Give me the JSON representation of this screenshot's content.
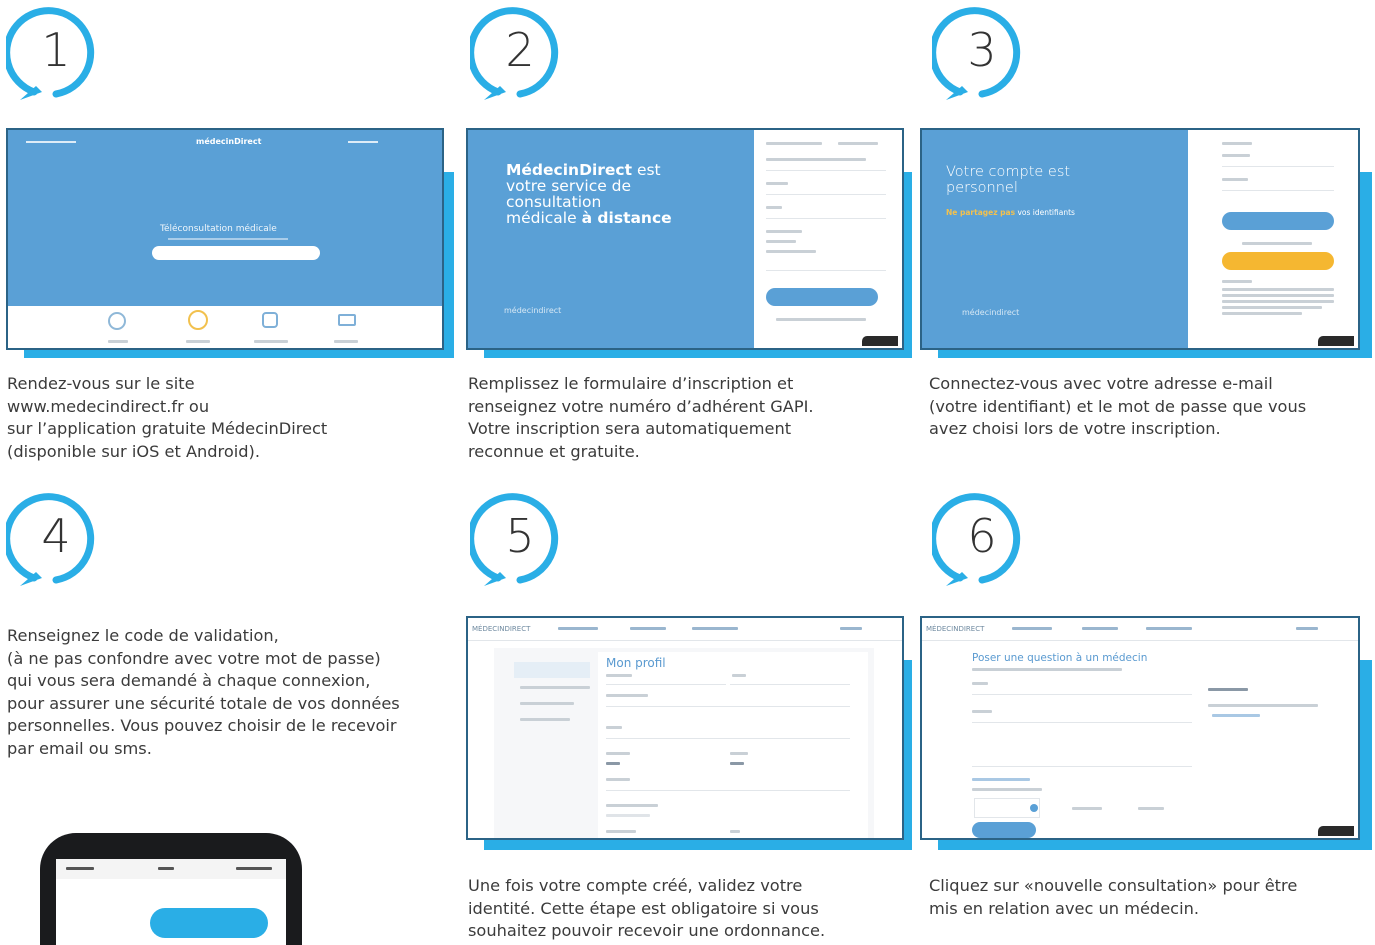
{
  "steps": [
    {
      "number": "1",
      "caption": "Rendez-vous sur le site\nwww.medecindirect.fr ou\nsur l’application gratuite MédecinDirect\n(disponible sur iOS et Android)."
    },
    {
      "number": "2",
      "caption": "Remplissez le formulaire d’inscription et\nrenseignez votre numéro d’adhérent GAPI.\nVotre inscription sera automatiquement\nreconnue et gratuite."
    },
    {
      "number": "3",
      "caption": "Connectez-vous avec votre adresse e-mail\n(votre identifiant) et le mot de passe que vous\navez choisi lors de votre inscription."
    },
    {
      "number": "4",
      "caption": "Renseignez le code de validation,\n(à ne pas confondre avec votre mot de passe)\nqui vous sera demandé à chaque connexion,\npour assurer une sécurité totale de vos données\npersonnelles. Vous pouvez choisir de le recevoir\npar email ou sms."
    },
    {
      "number": "5",
      "caption": "Une fois votre compte créé, validez votre\nidentité. Cette étape est obligatoire si vous\nsouhaitez pouvoir recevoir une ordonnance."
    },
    {
      "number": "6",
      "caption": "Cliquez sur «nouvelle consultation» pour être\nmis en relation avec un médecin."
    }
  ],
  "screens": {
    "s1": {
      "logo": "médecinDirect",
      "headline": "Téléconsultation médicale"
    },
    "s2": {
      "headline_bold": "MédecinDirect",
      "headline_rest": " est\nvotre service de\nconsultation\nmédicale ",
      "headline_tail": "à distance",
      "logo": "médecindirect"
    },
    "s3": {
      "headline": "Votre compte est\npersonnel",
      "subline_bold": "Ne partagez pas",
      "subline_rest": " vos identifiants",
      "logo": "médecindirect"
    },
    "s5": {
      "logo": "MÉDECINDIRECT",
      "title": "Mon profil"
    },
    "s6": {
      "logo": "MÉDECINDIRECT",
      "title": "Poser une question à un médecin"
    }
  },
  "colors": {
    "accent": "#2aaee6",
    "screen_blue": "#5aa0d6",
    "frame_border": "#2b6386"
  }
}
